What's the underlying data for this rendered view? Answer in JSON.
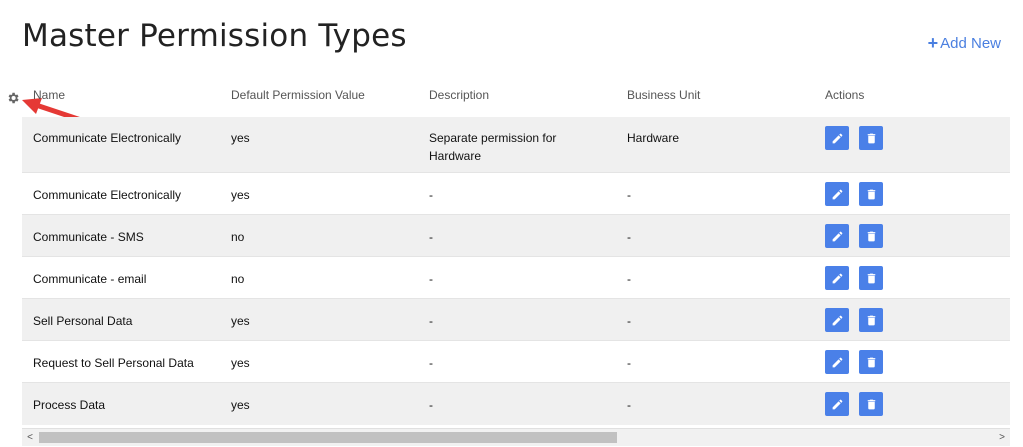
{
  "page": {
    "title": "Master Permission Types",
    "add_new_label": "Add New"
  },
  "colors": {
    "accent": "#4a80e8",
    "arrow": "#e53935"
  },
  "icons": {
    "settings": "gear-icon",
    "edit": "pencil-icon",
    "delete": "trash-icon",
    "annotation": "red-arrow-icon"
  },
  "table": {
    "headers": [
      "Name",
      "Default Permission Value",
      "Description",
      "Business Unit",
      "Actions"
    ],
    "rows": [
      {
        "name": "Communicate Electronically",
        "value": "yes",
        "description": "Separate permission for Hardware",
        "unit": "Hardware"
      },
      {
        "name": "Communicate Electronically",
        "value": "yes",
        "description": "-",
        "unit": "-"
      },
      {
        "name": "Communicate - SMS",
        "value": "no",
        "description": "-",
        "unit": "-"
      },
      {
        "name": "Communicate - email",
        "value": "no",
        "description": "-",
        "unit": "-"
      },
      {
        "name": "Sell Personal Data",
        "value": "yes",
        "description": "-",
        "unit": "-"
      },
      {
        "name": "Request to Sell Personal Data",
        "value": "yes",
        "description": "-",
        "unit": "-"
      },
      {
        "name": "Process Data",
        "value": "yes",
        "description": "-",
        "unit": "-"
      }
    ]
  },
  "scrollbar": {
    "left_glyph": "<",
    "right_glyph": ">",
    "position_fraction": 0.0
  }
}
